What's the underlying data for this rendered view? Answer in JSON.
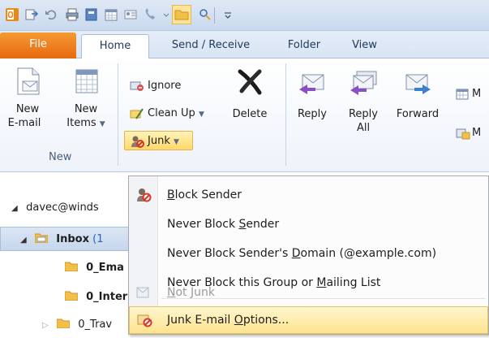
{
  "quick_access": {
    "icons": [
      "outlook-logo-icon",
      "send-receive-all-icon",
      "undo-icon",
      "print-icon",
      "address-book-icon",
      "calendar-grid-icon",
      "contact-card-icon",
      "phone-icon",
      "folder-icon",
      "search-people-icon",
      "customize-qat-icon"
    ]
  },
  "tabs": {
    "file": "File",
    "home": "Home",
    "send_receive": "Send / Receive",
    "folder": "Folder",
    "view": "View"
  },
  "ribbon": {
    "new_email": [
      "New",
      "E-mail"
    ],
    "new_items": [
      "New",
      "Items"
    ],
    "group_new": "New",
    "ignore": "Ignore",
    "clean_up": "Clean Up",
    "junk": "Junk",
    "delete": "Delete",
    "reply": "Reply",
    "reply_all": [
      "Reply",
      "All"
    ],
    "forward": "Forward",
    "meeting_1": "M",
    "meeting_2": "M"
  },
  "folder_pane": {
    "account": "davec@winds",
    "inbox": "Inbox",
    "inbox_count": "(1",
    "folder_1": "0_Ema",
    "folder_2": "0_Inter",
    "folder_3": "0_Trav"
  },
  "junk_menu": {
    "items": [
      {
        "label": "Block Sender",
        "underline": "B",
        "rest": "lock Sender",
        "icon": "block-sender-icon"
      },
      {
        "label": "Never Block Sender",
        "pre": "Never Block ",
        "underline": "S",
        "rest": "ender"
      },
      {
        "label": "Never Block Sender's Domain (@example.com)",
        "pre": "Never Block Sender's ",
        "underline": "D",
        "rest": "omain (@example.com)"
      },
      {
        "label": "Never Block this Group or Mailing List",
        "pre": "Never Block this Group or ",
        "underline": "M",
        "rest": "ailing List"
      },
      {
        "label": "Not Junk",
        "pre": "",
        "underline": "N",
        "rest": "ot Junk",
        "icon": "not-junk-icon",
        "disabled": true
      },
      {
        "label": "Junk E-mail Options...",
        "pre": "Junk E-mail ",
        "underline": "O",
        "rest": "ptions...",
        "icon": "junk-options-icon"
      }
    ]
  },
  "colors": {
    "file_tab": "#e7690f",
    "highlight": "#ffe48f",
    "ribbon_bg": "#eef3fa"
  }
}
